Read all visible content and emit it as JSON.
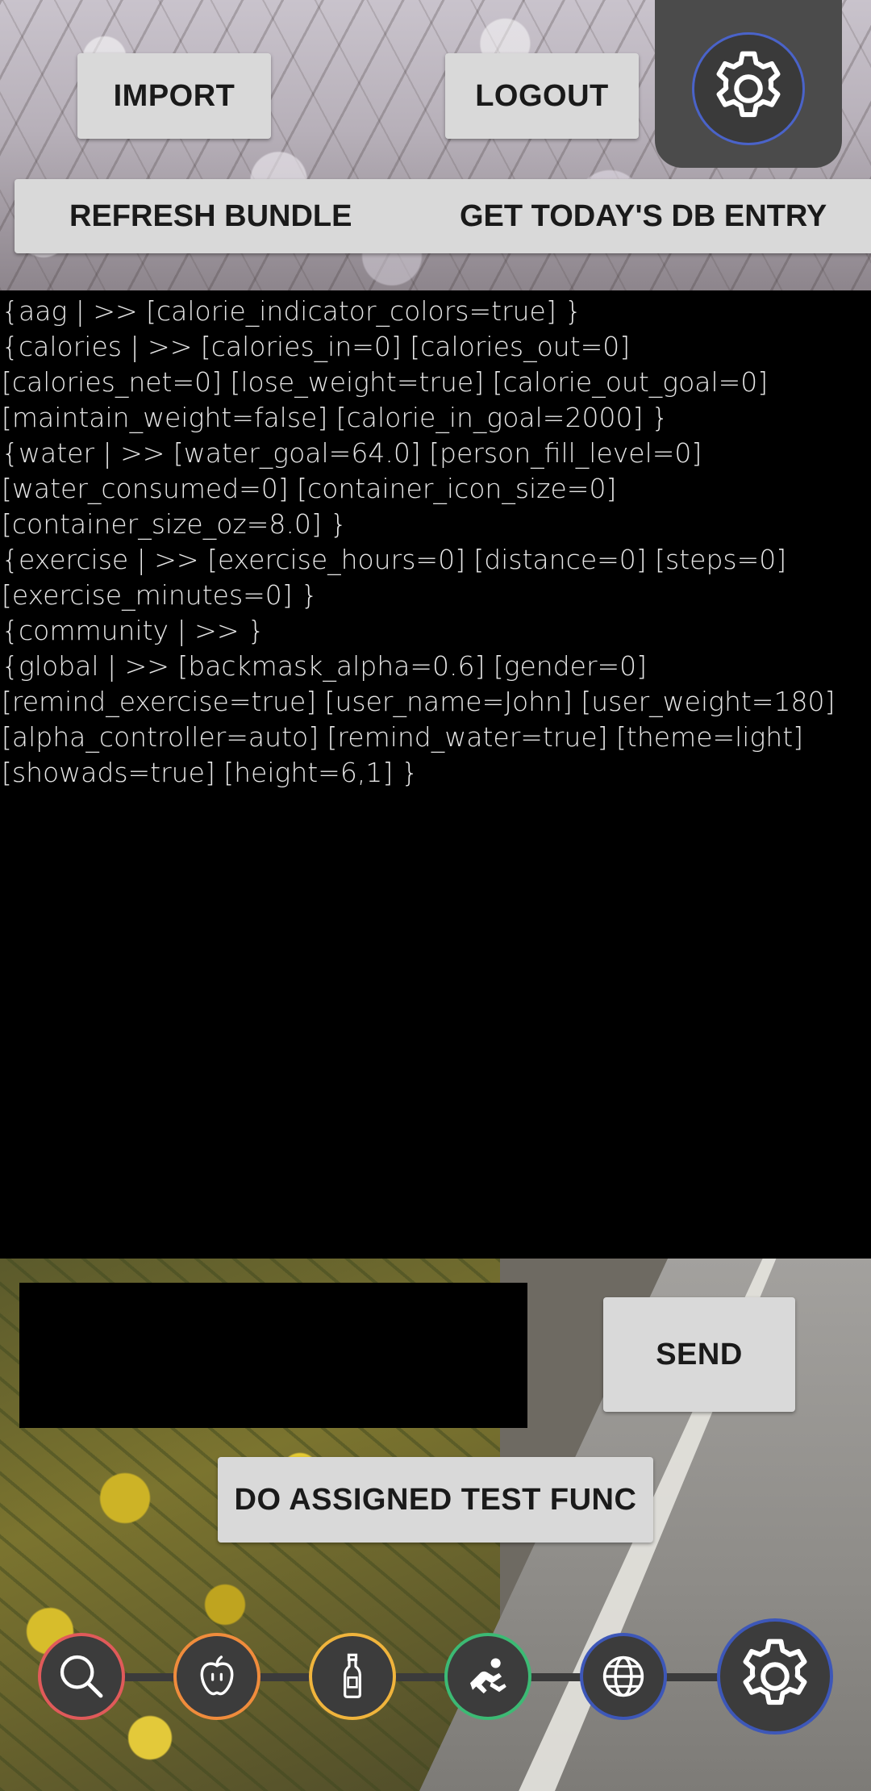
{
  "top_bar": {
    "import_label": "IMPORT",
    "logout_label": "LOGOUT",
    "settings_icon": "gear-icon",
    "refresh_label": "REFRESH BUNDLE",
    "db_entry_label": "GET TODAY'S DB ENTRY"
  },
  "console": {
    "lines": [
      "{aag | >> [calorie_indicator_colors=true] }",
      "{calories | >> [calories_in=0] [calories_out=0]",
      "[calories_net=0] [lose_weight=true] [calorie_out_goal=0]",
      "[maintain_weight=false] [calorie_in_goal=2000] }",
      "{water | >> [water_goal=64.0] [person_fill_level=0]",
      "[water_consumed=0] [container_icon_size=0]",
      "[container_size_oz=8.0] }",
      "{exercise | >> [exercise_hours=0] [distance=0] [steps=0]",
      "[exercise_minutes=0] }",
      "{community | >> }",
      "{global | >> [backmask_alpha=0.6] [gender=0]",
      "[remind_exercise=true] [user_name=John] [user_weight=180]",
      "[alpha_controller=auto] [remind_water=true] [theme=light]",
      "[showads=true] [height=6,1] }"
    ]
  },
  "message": {
    "value": "",
    "send_label": "SEND"
  },
  "test": {
    "label": "DO ASSIGNED TEST FUNC"
  },
  "bottom_nav": {
    "items": [
      {
        "icon": "search-icon",
        "color": "#e05a5a"
      },
      {
        "icon": "apple-icon",
        "color": "#f08c3c"
      },
      {
        "icon": "bottle-icon",
        "color": "#f0b43c"
      },
      {
        "icon": "exercise-icon",
        "color": "#3cba74"
      },
      {
        "icon": "globe-icon",
        "color": "#3d57b8"
      },
      {
        "icon": "gear-icon",
        "color": "#3d57b8"
      }
    ]
  }
}
